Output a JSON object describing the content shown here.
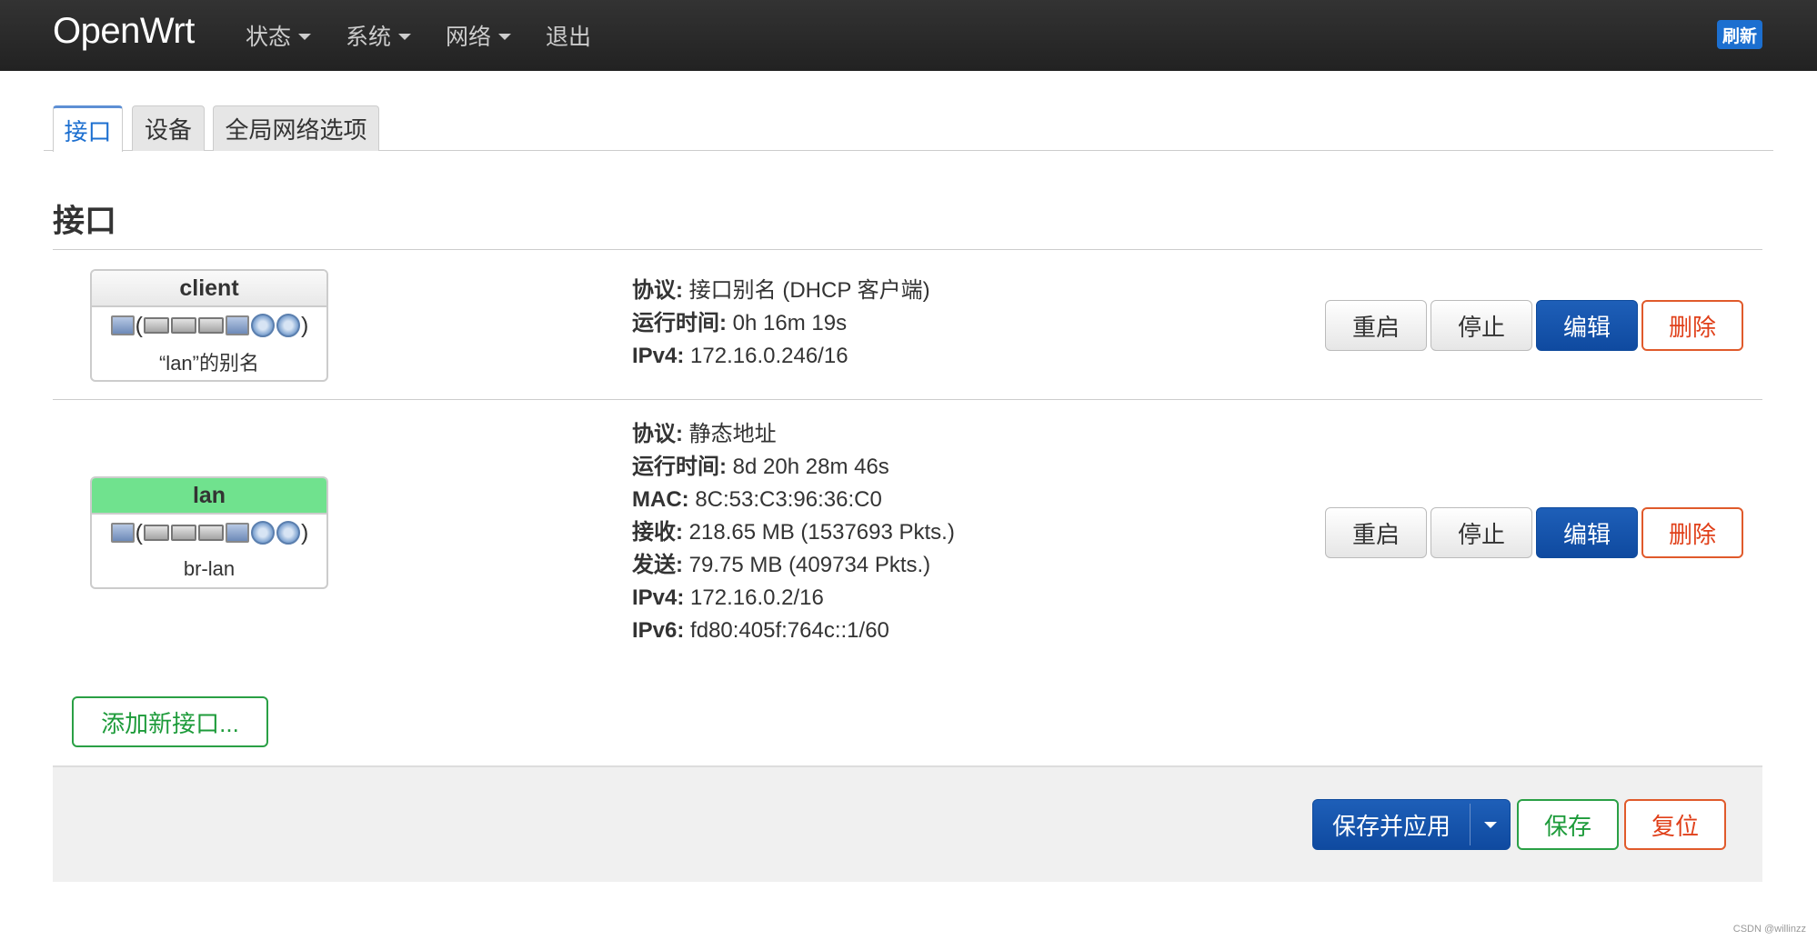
{
  "nav": {
    "brand": "OpenWrt",
    "menu": [
      {
        "label": "状态",
        "dropdown": true
      },
      {
        "label": "系统",
        "dropdown": true
      },
      {
        "label": "网络",
        "dropdown": true
      },
      {
        "label": "退出",
        "dropdown": false
      }
    ],
    "refresh_label": "刷新"
  },
  "tabs": [
    {
      "label": "接口",
      "active": true
    },
    {
      "label": "设备",
      "active": false
    },
    {
      "label": "全局网络选项",
      "active": false
    }
  ],
  "section_title": "接口",
  "interfaces": [
    {
      "name": "client",
      "header_color": "#e8e8e8",
      "device_icons": [
        "pc",
        "switch",
        "switch",
        "switch",
        "pc",
        "wireless",
        "wireless"
      ],
      "subtitle": "“lan”的别名",
      "info": [
        {
          "label": "协议:",
          "value": "接口别名 (DHCP 客户端)"
        },
        {
          "label": "运行时间:",
          "value": "0h 16m 19s"
        },
        {
          "label": "IPv4:",
          "value": "172.16.0.246/16"
        }
      ],
      "buttons": {
        "restart": "重启",
        "stop": "停止",
        "edit": "编辑",
        "delete": "删除"
      }
    },
    {
      "name": "lan",
      "header_color": "#70e28e",
      "device_icons": [
        "pc",
        "switch",
        "switch",
        "switch",
        "pc",
        "wireless",
        "wireless"
      ],
      "subtitle": "br-lan",
      "info": [
        {
          "label": "协议:",
          "value": "静态地址"
        },
        {
          "label": "运行时间:",
          "value": "8d 20h 28m 46s"
        },
        {
          "label": "MAC:",
          "value": "8C:53:C3:96:36:C0"
        },
        {
          "label": "接收:",
          "value": "218.65 MB (1537693 Pkts.)"
        },
        {
          "label": "发送:",
          "value": "79.75 MB (409734 Pkts.)"
        },
        {
          "label": "IPv4:",
          "value": "172.16.0.2/16"
        },
        {
          "label": "IPv6:",
          "value": "fd80:405f:764c::1/60"
        }
      ],
      "buttons": {
        "restart": "重启",
        "stop": "停止",
        "edit": "编辑",
        "delete": "删除"
      }
    }
  ],
  "add_interface_label": "添加新接口...",
  "footer": {
    "save_apply": "保存并应用",
    "save": "保存",
    "reset": "复位"
  },
  "watermark": "CSDN @willinzz"
}
